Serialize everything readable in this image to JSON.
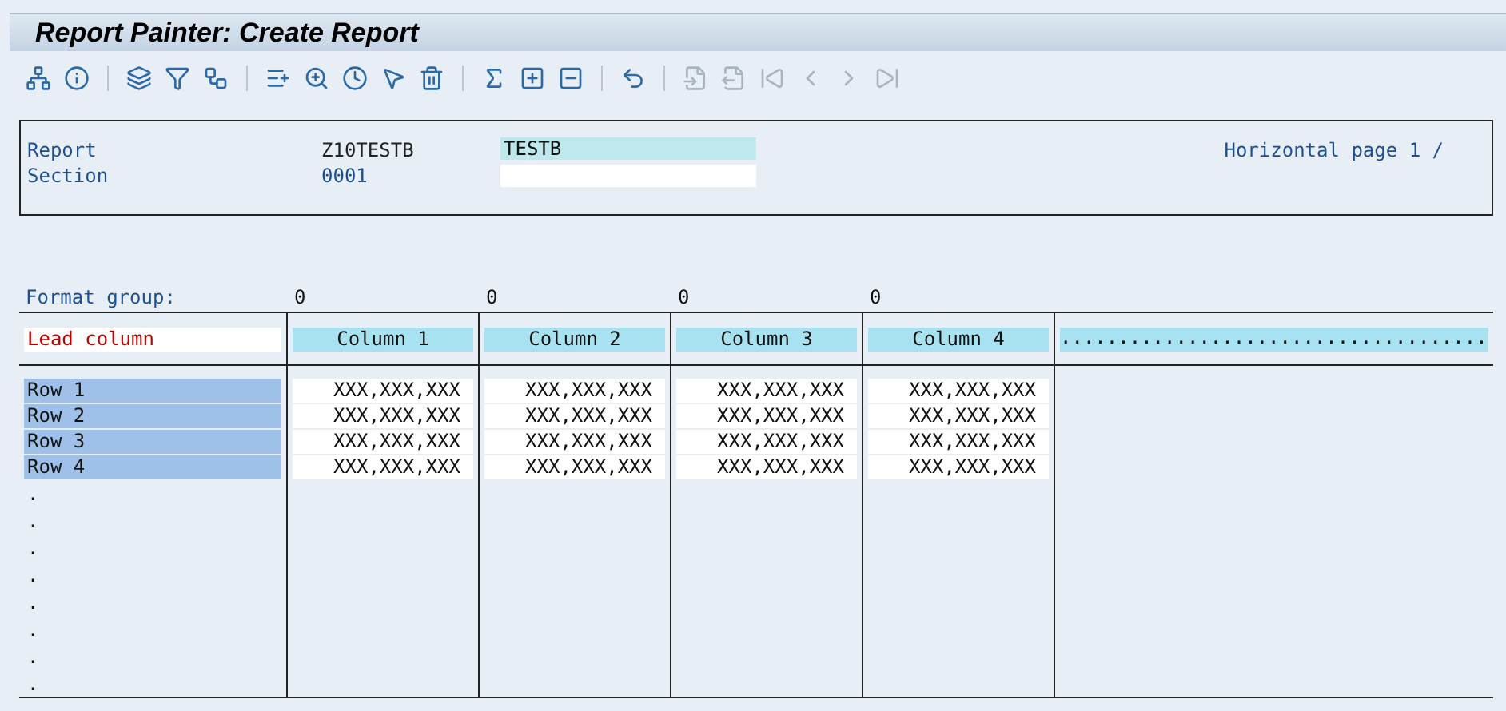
{
  "window": {
    "title": "Report Painter: Create Report"
  },
  "toolbar": [
    [
      {
        "disabled": false
      },
      {
        "disabled": false
      }
    ],
    [
      {
        "disabled": false
      },
      {
        "disabled": false
      },
      {
        "disabled": false
      }
    ],
    [
      {
        "disabled": false
      },
      {
        "disabled": false
      },
      {
        "disabled": false
      },
      {
        "disabled": false
      },
      {
        "disabled": false
      }
    ],
    [
      {
        "disabled": false
      },
      {
        "disabled": false
      },
      {
        "disabled": false
      }
    ],
    [
      {
        "disabled": false
      }
    ],
    [
      {
        "disabled": true
      },
      {
        "disabled": true
      },
      {
        "disabled": true
      },
      {
        "disabled": true
      },
      {
        "disabled": true
      },
      {
        "disabled": true
      }
    ]
  ],
  "header": {
    "report_label": "Report",
    "report_id": "Z10TESTB",
    "report_name": "TESTB",
    "section_label": "Section",
    "section_id": "0001",
    "page_info": "Horizontal page 1  /"
  },
  "format_group": {
    "label": "Format group:",
    "values": [
      "0",
      "0",
      "0",
      "0"
    ]
  },
  "table": {
    "lead_column": "Lead column",
    "columns": [
      "Column 1",
      "Column 2",
      "Column 3",
      "Column 4"
    ],
    "overflow_header": ".....................................",
    "rows": [
      {
        "label": "Row 1",
        "cells": [
          "XXX,XXX,XXX",
          "XXX,XXX,XXX",
          "XXX,XXX,XXX",
          "XXX,XXX,XXX"
        ]
      },
      {
        "label": "Row 2",
        "cells": [
          "XXX,XXX,XXX",
          "XXX,XXX,XXX",
          "XXX,XXX,XXX",
          "XXX,XXX,XXX"
        ]
      },
      {
        "label": "Row 3",
        "cells": [
          "XXX,XXX,XXX",
          "XXX,XXX,XXX",
          "XXX,XXX,XXX",
          "XXX,XXX,XXX"
        ]
      },
      {
        "label": "Row 4",
        "cells": [
          "XXX,XXX,XXX",
          "XXX,XXX,XXX",
          "XXX,XXX,XXX",
          "XXX,XXX,XXX"
        ]
      }
    ],
    "empty_rows": [
      ".",
      ".",
      ".",
      ".",
      ".",
      ".",
      ".",
      "."
    ]
  }
}
